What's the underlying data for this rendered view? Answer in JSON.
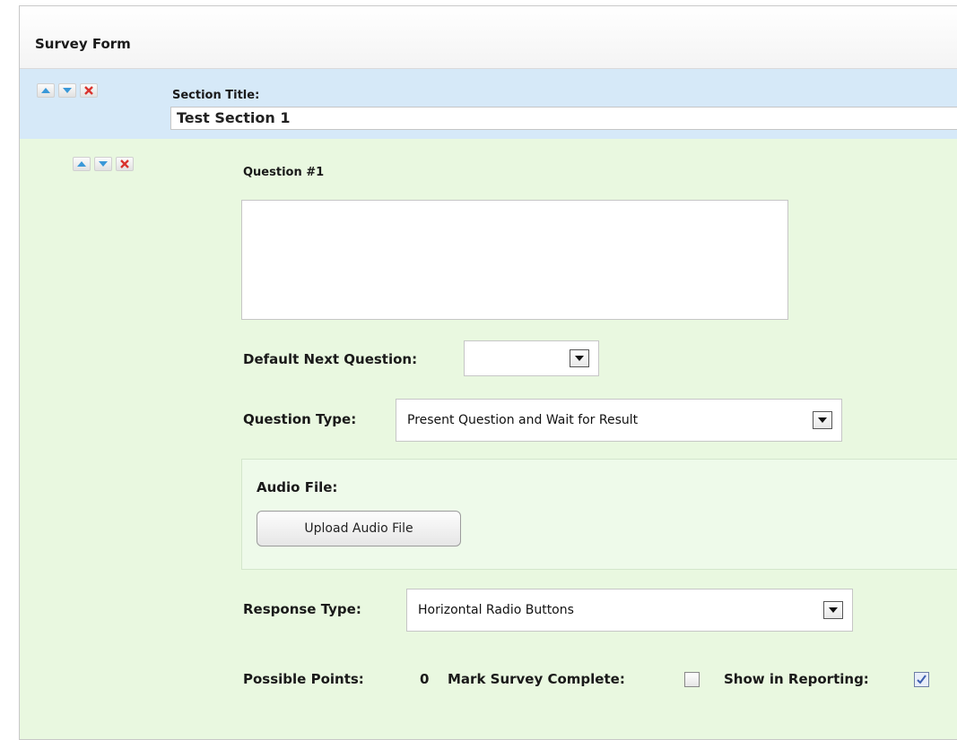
{
  "form": {
    "title": "Survey Form"
  },
  "section": {
    "title_label": "Section Title:",
    "title_value": "Test Section 1",
    "controls": [
      "move-up-icon",
      "move-down-icon",
      "delete-icon"
    ]
  },
  "question": {
    "heading": "Question #1",
    "text_value": "",
    "default_next_label": "Default Next Question:",
    "default_next_value": "",
    "type_label": "Question Type:",
    "type_value": "Present Question and Wait for Result",
    "audio_label": "Audio File:",
    "upload_button": "Upload Audio File",
    "response_type_label": "Response Type:",
    "response_type_value": "Horizontal Radio Buttons",
    "possible_points_label": "Possible Points:",
    "possible_points_value": "0",
    "mark_complete_label": "Mark Survey Complete:",
    "mark_complete_checked": false,
    "show_reporting_label": "Show in Reporting:",
    "show_reporting_checked": true
  },
  "colors": {
    "section_bg": "#d6e9f8",
    "question_bg": "#e9f8e0",
    "arrow_blue": "#3a98d8",
    "delete_red": "#d9332d"
  }
}
